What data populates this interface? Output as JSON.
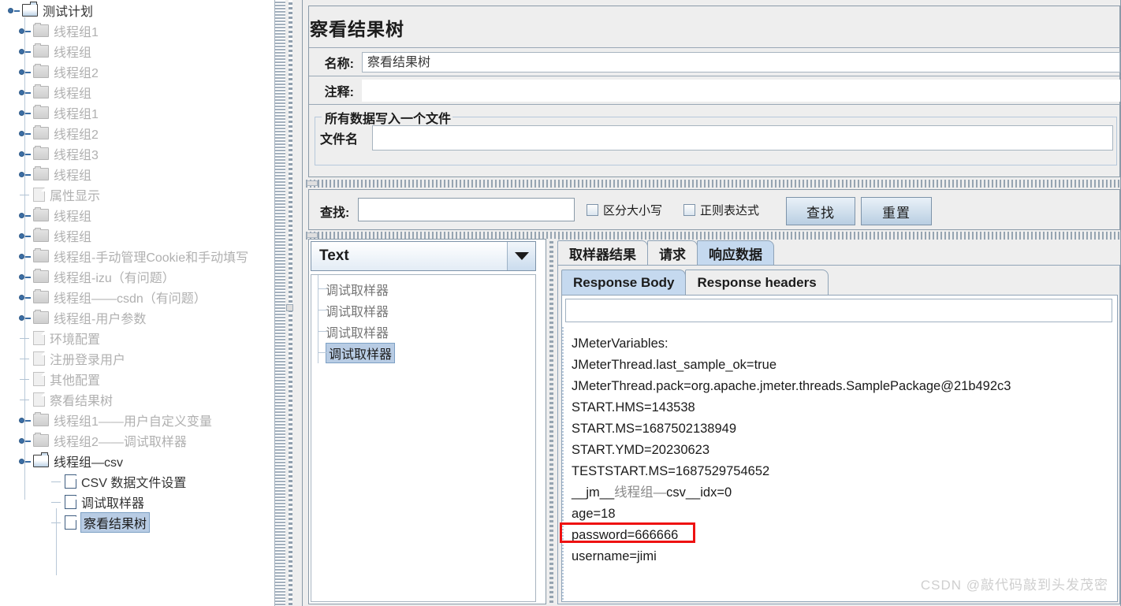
{
  "tree": {
    "root": {
      "label": "测试计划",
      "icon": "folder-open-icon"
    },
    "items": [
      {
        "label": "线程组1",
        "type": "folder",
        "state": "dim"
      },
      {
        "label": "线程组",
        "type": "folder",
        "state": "dim"
      },
      {
        "label": "线程组2",
        "type": "folder",
        "state": "dim"
      },
      {
        "label": "线程组",
        "type": "folder",
        "state": "dim"
      },
      {
        "label": "线程组1",
        "type": "folder",
        "state": "dim"
      },
      {
        "label": "线程组2",
        "type": "folder",
        "state": "dim"
      },
      {
        "label": "线程组3",
        "type": "folder",
        "state": "dim"
      },
      {
        "label": "线程组",
        "type": "folder",
        "state": "dim"
      },
      {
        "label": "属性显示",
        "type": "doc",
        "state": "dim"
      },
      {
        "label": "线程组",
        "type": "folder",
        "state": "dim"
      },
      {
        "label": "线程组",
        "type": "folder",
        "state": "dim"
      },
      {
        "label": "线程组-手动管理Cookie和手动填写",
        "type": "folder",
        "state": "dim"
      },
      {
        "label": "线程组-izu（有问题）",
        "type": "folder",
        "state": "dim"
      },
      {
        "label": "线程组——csdn（有问题）",
        "type": "folder",
        "state": "dim"
      },
      {
        "label": "线程组-用户参数",
        "type": "folder",
        "state": "dim"
      },
      {
        "label": "环境配置",
        "type": "doc",
        "state": "dim"
      },
      {
        "label": "注册登录用户",
        "type": "doc",
        "state": "dim"
      },
      {
        "label": "其他配置",
        "type": "doc",
        "state": "dim"
      },
      {
        "label": "察看结果树",
        "type": "doc",
        "state": "dim"
      },
      {
        "label": "线程组1——用户自定义变量",
        "type": "folder",
        "state": "dim"
      },
      {
        "label": "线程组2——调试取样器",
        "type": "folder",
        "state": "dim"
      },
      {
        "label": "线程组—csv",
        "type": "folder-open",
        "state": "active"
      }
    ],
    "csv_children": [
      {
        "label": "CSV 数据文件设置",
        "type": "doc-blue",
        "state": "active"
      },
      {
        "label": "调试取样器",
        "type": "doc-blue",
        "state": "active"
      },
      {
        "label": "察看结果树",
        "type": "doc-blue",
        "state": "selected"
      }
    ]
  },
  "panel": {
    "title": "察看结果树",
    "name_label": "名称:",
    "name_value": "察看结果树",
    "comment_label": "注释:",
    "comment_value": "",
    "groupbox_title": "所有数据写入一个文件",
    "filename_label": "文件名",
    "filename_value": ""
  },
  "search": {
    "label": "查找:",
    "value": "",
    "case_sensitive_label": "区分大小写",
    "case_sensitive_checked": false,
    "regex_label": "正则表达式",
    "regex_checked": false,
    "find_button": "查找",
    "reset_button": "重置"
  },
  "renderer": {
    "selected": "Text"
  },
  "results_tree": {
    "items": [
      {
        "label": "调试取样器",
        "selected": false
      },
      {
        "label": "调试取样器",
        "selected": false
      },
      {
        "label": "调试取样器",
        "selected": false
      },
      {
        "label": "调试取样器",
        "selected": true
      }
    ]
  },
  "tabs": {
    "main": [
      {
        "label": "取样器结果",
        "active": false
      },
      {
        "label": "请求",
        "active": false
      },
      {
        "label": "响应数据",
        "active": true
      }
    ],
    "sub": [
      {
        "label": "Response Body",
        "active": true
      },
      {
        "label": "Response headers",
        "active": false
      }
    ]
  },
  "response": {
    "search_field_value": "",
    "lines": [
      "JMeterVariables:",
      "JMeterThread.last_sample_ok=true",
      "JMeterThread.pack=org.apache.jmeter.threads.SamplePackage@21b492c3",
      "START.HMS=143538",
      "START.MS=1687502138949",
      "START.YMD=20230623",
      "TESTSTART.MS=1687529754652",
      "__jm__线程组—csv__idx=0",
      "age=18",
      "password=666666",
      "username=jimi"
    ],
    "highlighted_line": "age=18"
  },
  "watermark": "CSDN @敲代码敲到头发茂密",
  "colors": {
    "selection": "#b8cce4",
    "accent": "#3b6ea5",
    "highlight_box": "#ee1111",
    "panel_bg": "#eeeeee",
    "tab_active": "#c5d9ef"
  }
}
